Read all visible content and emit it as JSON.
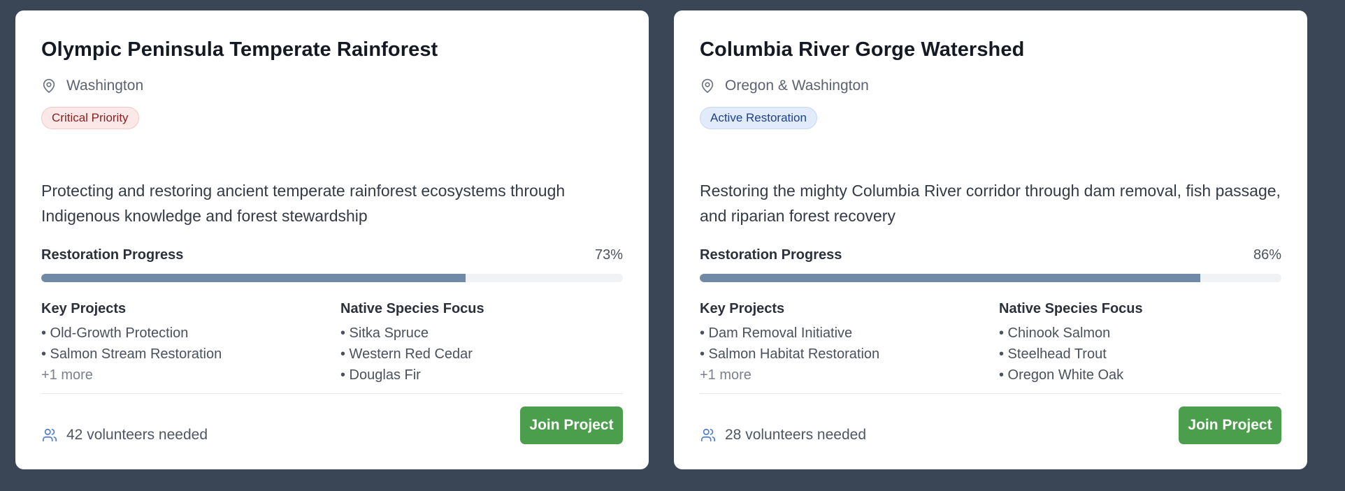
{
  "colors": {
    "background": "#3a4656",
    "card": "#ffffff",
    "progress_fill": "#7089a6",
    "join_button": "#4a9e4c",
    "icon_accent": "#4a7bd0"
  },
  "labels": {
    "progress": "Restoration Progress",
    "key_projects": "Key Projects",
    "native_species": "Native Species Focus",
    "join": "Join Project"
  },
  "cards": [
    {
      "title": "Olympic Peninsula Temperate Rainforest",
      "location": "Washington",
      "location_icon": "map-pin-icon",
      "badge": "Critical Priority",
      "badge_style": "critical",
      "description": "Protecting and restoring ancient temperate rainforest ecosystems through Indigenous knowledge and forest stewardship",
      "progress_value": 0.73,
      "progress_text": "73%",
      "projects": [
        "• Old-Growth Protection",
        "• Salmon Stream Restoration"
      ],
      "projects_more": "+1 more",
      "species": [
        "• Sitka Spruce",
        "• Western Red Cedar",
        "• Douglas Fir"
      ],
      "volunteers_icon": "users-icon",
      "volunteers": "42 volunteers needed"
    },
    {
      "title": "Columbia River Gorge Watershed",
      "location": "Oregon & Washington",
      "location_icon": "map-pin-icon",
      "badge": "Active Restoration",
      "badge_style": "active",
      "description": "Restoring the mighty Columbia River corridor through dam removal, fish passage, and riparian forest recovery",
      "progress_value": 0.86,
      "progress_text": "86%",
      "projects": [
        "• Dam Removal Initiative",
        "• Salmon Habitat Restoration"
      ],
      "projects_more": "+1 more",
      "species": [
        "• Chinook Salmon",
        "• Steelhead Trout",
        "• Oregon White Oak"
      ],
      "volunteers_icon": "users-icon",
      "volunteers": "28 volunteers needed"
    }
  ]
}
